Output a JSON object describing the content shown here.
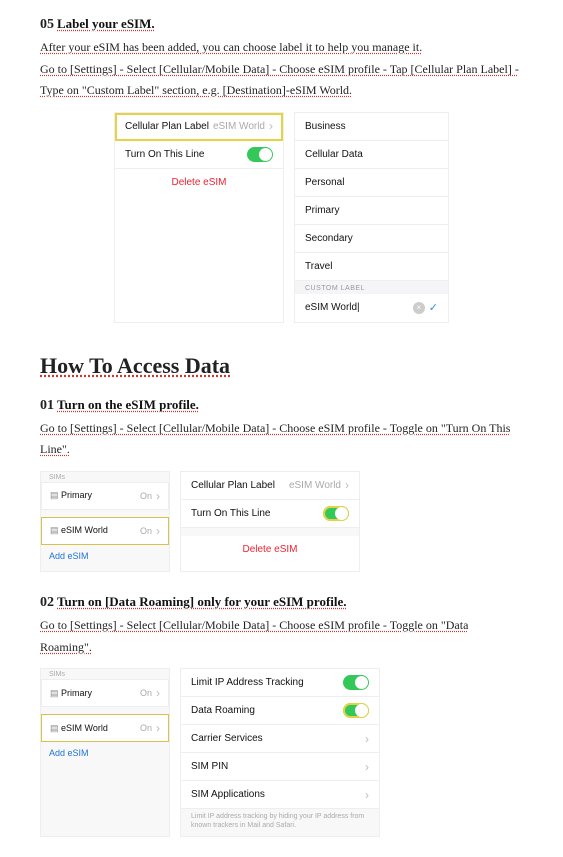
{
  "step05": {
    "num": "05",
    "title": "Label your eSIM.",
    "para": "After your eSIM has been added, you can choose label it to help you manage it.",
    "para2": "Go to [Settings] - Select [Cellular/Mobile Data] - Choose eSIM profile - Tap [Cellular Plan Label] - Type on \"Custom Label\" section, e.g. [Destination]-eSIM World."
  },
  "panel05_left": {
    "row1_label": "Cellular Plan Label",
    "row1_value": "eSIM World",
    "row2_label": "Turn On This Line",
    "delete": "Delete eSIM"
  },
  "panel05_right": {
    "options": [
      "Business",
      "Cellular Data",
      "Personal",
      "Primary",
      "Secondary",
      "Travel"
    ],
    "custom_hdr": "CUSTOM LABEL",
    "custom_value": "eSIM World|"
  },
  "h2": "How To Access Data",
  "step01": {
    "num": "01",
    "title": "Turn on the eSIM profile.",
    "para": "Go to [Settings] - Select [Cellular/Mobile Data] - Choose eSIM profile - Toggle on \"Turn On This Line\"."
  },
  "sim_list": {
    "hdr": "SIMs",
    "primary": "Primary",
    "on": "On",
    "esim": "eSIM World",
    "add": "Add eSIM"
  },
  "panel01_right": {
    "row1_label": "Cellular Plan Label",
    "row1_value": "eSIM World",
    "row2_label": "Turn On This Line",
    "delete": "Delete eSIM"
  },
  "step02": {
    "num": "02",
    "title": "Turn on [Data Roaming] only for your eSIM profile.",
    "para": "Go to [Settings] - Select [Cellular/Mobile Data] - Choose eSIM profile - Toggle on \"Data Roaming\"."
  },
  "panel02_right": {
    "r1": "Limit IP Address Tracking",
    "r2": "Data Roaming",
    "r3": "Carrier Services",
    "r4": "SIM PIN",
    "r5": "SIM Applications",
    "foot": "Limit IP address tracking by hiding your IP address from known trackers in Mail and Safari."
  }
}
